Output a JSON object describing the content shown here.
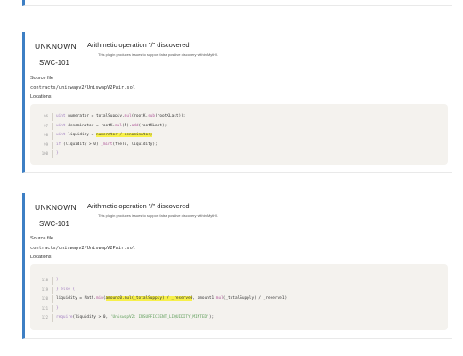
{
  "issues": [
    {
      "severity": "UNKNOWN",
      "swc": "SWC-101",
      "title": "Arithmetic operation \"/\" discovered",
      "description": "This plugin produces issues to support false positive discovery within MythX.",
      "source_label": "Source file",
      "source_path": "contracts/uniswapv2/UniswapV2Pair.sol",
      "locations_label": "Locations",
      "code_lines": [
        {
          "num": "96",
          "segments": [
            {
              "t": "uint ",
              "c": "kw"
            },
            {
              "t": "numerator = totalSupply."
            },
            {
              "t": "mul",
              "c": "fn"
            },
            {
              "t": "(rootK."
            },
            {
              "t": "sub",
              "c": "fn"
            },
            {
              "t": "(rootKLast));"
            }
          ]
        },
        {
          "num": "97",
          "segments": [
            {
              "t": "uint ",
              "c": "kw"
            },
            {
              "t": "denominator = rootK."
            },
            {
              "t": "mul",
              "c": "fn"
            },
            {
              "t": "(5)."
            },
            {
              "t": "add",
              "c": "fn"
            },
            {
              "t": "(rootKLast);"
            }
          ]
        },
        {
          "num": "98",
          "segments": [
            {
              "t": "uint ",
              "c": "kw"
            },
            {
              "t": "liquidity = "
            },
            {
              "t": "numerator / denominator;",
              "c": "hl"
            }
          ]
        },
        {
          "num": "99",
          "segments": [
            {
              "t": "if ",
              "c": "kw"
            },
            {
              "t": "(liquidity > 0) "
            },
            {
              "t": "_mint",
              "c": "fn"
            },
            {
              "t": "(feeTo, liquidity);"
            }
          ]
        },
        {
          "num": "100",
          "segments": [
            {
              "t": "}",
              "c": "kw"
            }
          ]
        }
      ]
    },
    {
      "severity": "UNKNOWN",
      "swc": "SWC-101",
      "title": "Arithmetic operation \"/\" discovered",
      "description": "This plugin produces issues to support false positive discovery within MythX.",
      "source_label": "Source file",
      "source_path": "contracts/uniswapv2/UniswapV2Pair.sol",
      "locations_label": "Locations",
      "code_lines": [
        {
          "num": "118",
          "segments": [
            {
              "t": "}",
              "c": "kw"
            }
          ]
        },
        {
          "num": "119",
          "segments": [
            {
              "t": "} else {",
              "c": "kw"
            }
          ]
        },
        {
          "num": "120",
          "segments": [
            {
              "t": "liquidity = Math."
            },
            {
              "t": "min",
              "c": "fn"
            },
            {
              "t": "("
            },
            {
              "t": "amount0.mul(_totalSupply) / _reserve0",
              "c": "hl"
            },
            {
              "t": ", amount1."
            },
            {
              "t": "mul",
              "c": "fn"
            },
            {
              "t": "(_totalSupply) / _reserve1);"
            }
          ]
        },
        {
          "num": "121",
          "segments": [
            {
              "t": "}",
              "c": "kw"
            }
          ]
        },
        {
          "num": "122",
          "segments": [
            {
              "t": "require",
              "c": "kw"
            },
            {
              "t": "(liquidity > 0, "
            },
            {
              "t": "'UniswapV2: INSUFFICIENT_LIQUIDITY_MINTED'",
              "c": "str"
            },
            {
              "t": ");"
            }
          ]
        }
      ]
    }
  ],
  "top_stub": {
    "line_num": "7"
  }
}
